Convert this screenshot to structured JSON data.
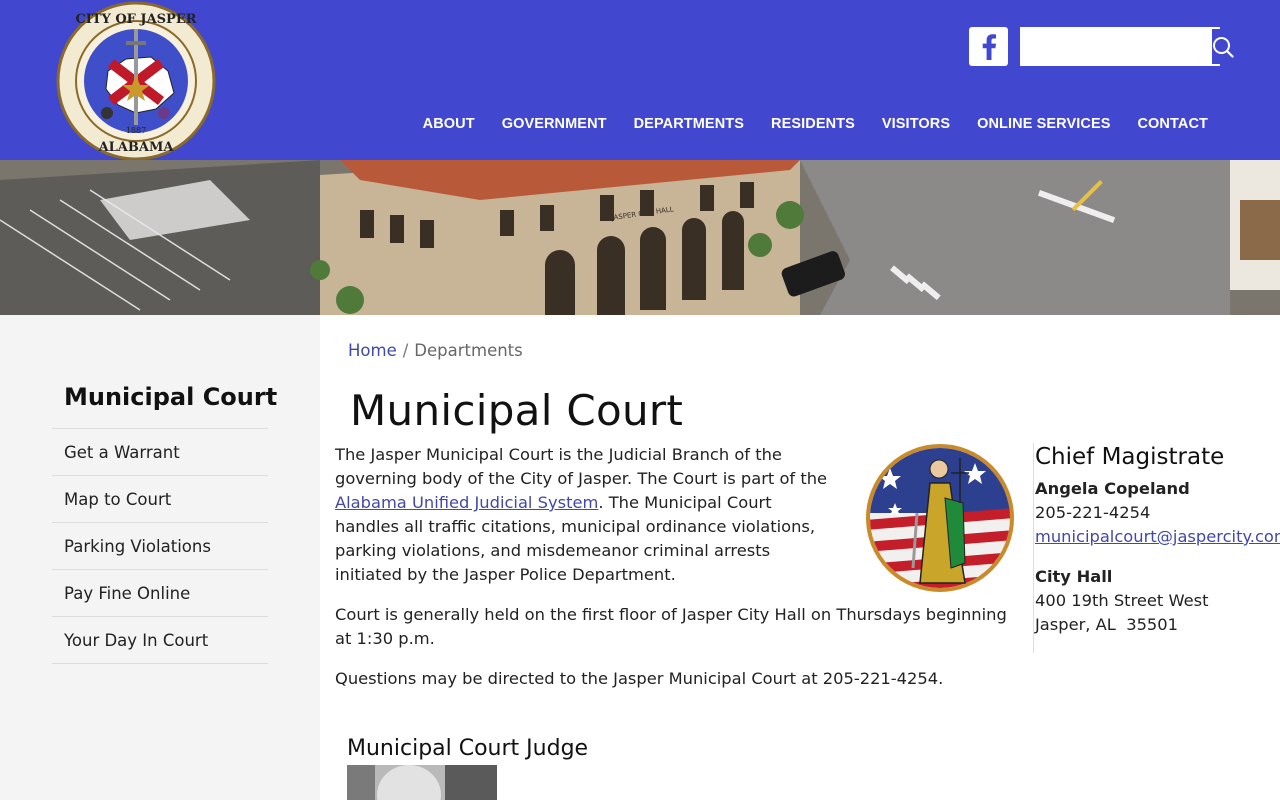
{
  "header": {
    "seal_text": "CITY OF JASPER",
    "seal_bottom": "ALABAMA",
    "seal_year": "1887",
    "search_placeholder": "",
    "nav": [
      "ABOUT",
      "GOVERNMENT",
      "DEPARTMENTS",
      "RESIDENTS",
      "VISITORS",
      "ONLINE SERVICES",
      "CONTACT"
    ]
  },
  "hero": {
    "sign_text": "JASPER CITY HALL"
  },
  "sidebar": {
    "title": "Municipal Court",
    "items": [
      "Get a Warrant",
      "Map to Court",
      "Parking Violations",
      "Pay Fine Online",
      "Your Day In Court"
    ]
  },
  "breadcrumb": {
    "home": "Home",
    "sep": "/",
    "current": "Departments"
  },
  "main": {
    "title": "Municipal Court",
    "p1_a": "The Jasper Municipal Court is the Judicial Branch of the governing body of the City of Jasper. The Court is part of the ",
    "p1_link": "Alabama Unified Judicial System",
    "p1_b": ". The Municipal Court handles all traffic citations, municipal ordinance violations, parking violations, and misdemeanor criminal arrests initiated by the Jasper Police Department.",
    "p2": "Court is generally held on the first floor of Jasper City Hall on Thursdays beginning at 1:30 p.m.",
    "p3": "Questions may be directed to the Jasper Municipal Court at 205-221-4254.",
    "judge_heading": "Municipal Court Judge"
  },
  "contact": {
    "heading": "Chief Magistrate",
    "name": "Angela Copeland",
    "phone": "205-221-4254",
    "email": "municipalcourt@jaspercity.com",
    "place": "City Hall",
    "street": "400 19th Street West",
    "city": "Jasper, AL  35501"
  },
  "colors": {
    "brand_blue": "#4148cf",
    "link": "#4148a8",
    "sidebar_bg": "#f4f4f4"
  },
  "icons": [
    "facebook-icon",
    "search-icon"
  ]
}
